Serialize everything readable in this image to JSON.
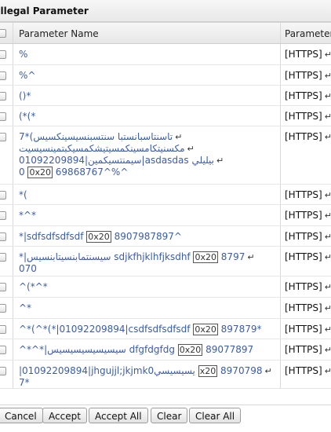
{
  "dialog": {
    "title": "Illegal Parameter"
  },
  "table": {
    "columns": [
      "Parameter Name",
      "Parameter Location"
    ],
    "rows": [
      {
        "lines": [
          "%"
        ],
        "location": "[HTTPS]"
      },
      {
        "lines": [
          "%^"
        ],
        "location": "[HTTPS]"
      },
      {
        "lines": [
          "()*"
        ],
        "location": "[HTTPS]"
      },
      {
        "lines": [
          "(*(*"
        ],
        "location": "[HTTPS]"
      },
      {
        "lines": [
          "7*(تاسنتاسبانستبا سنتسبنسيسينكسيس",
          "مكسنيتكامسينكمسيتيشكمسيكبتمينسيسيت",
          "01092209894|سيمنتسيكمين|asdasdas بيليلي",
          "0 [0x20] 69868767^%^"
        ],
        "location": "[HTTPS]"
      },
      {
        "lines": [
          "*("
        ],
        "location": "[HTTPS]"
      },
      {
        "lines": [
          "*^*"
        ],
        "location": "[HTTPS]"
      },
      {
        "lines": [
          "*|sdfsdfsdfsdf [0x20] 8907987897^"
        ],
        "location": "[HTTPS]"
      },
      {
        "lines": [
          "*|سيسنتمابنسيتابنسيس sdjkfhjklhfjksdhf [0x20] 8797",
          "070"
        ],
        "location": "[HTTPS]"
      },
      {
        "lines": [
          "^(*^*"
        ],
        "location": "[HTTPS]"
      },
      {
        "lines": [
          "^*"
        ],
        "location": "[HTTPS]"
      },
      {
        "lines": [
          "^*(^*(*|01092209894|csdfsdfsdfsdf [0x20] 897879*"
        ],
        "location": "[HTTPS]"
      },
      {
        "lines": [
          "^*^*|سيسيسيسيسيسيس dfgfdgfdg [0x20] 89077897"
        ],
        "location": "[HTTPS]"
      },
      {
        "lines": [
          "|01092209894|jhgujjl;jkjmk0يسيسيسي [x20] 8970798",
          "7*"
        ],
        "location": "[HTTPS]"
      }
    ]
  },
  "buttons": [
    "Cancel",
    "Accept",
    "Accept All",
    "Clear",
    "Clear All"
  ]
}
